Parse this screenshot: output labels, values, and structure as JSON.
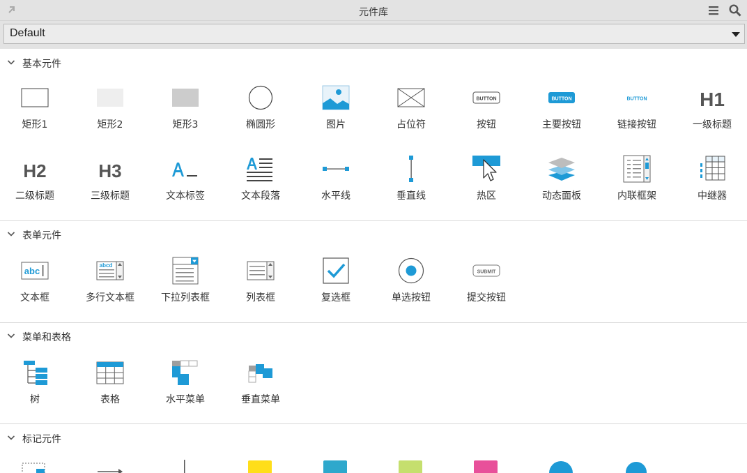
{
  "window": {
    "title": "元件库"
  },
  "library": {
    "selected": "Default"
  },
  "colors": {
    "accent": "#1e9ad6",
    "header_bg": "#e3e3e3"
  },
  "sections": [
    {
      "title": "基本元件",
      "items": [
        {
          "label": "矩形1",
          "icon": "rectangle-outline-icon"
        },
        {
          "label": "矩形2",
          "icon": "rectangle-light-icon"
        },
        {
          "label": "矩形3",
          "icon": "rectangle-gray-icon"
        },
        {
          "label": "椭圆形",
          "icon": "ellipse-icon"
        },
        {
          "label": "图片",
          "icon": "image-icon"
        },
        {
          "label": "占位符",
          "icon": "placeholder-icon"
        },
        {
          "label": "按钮",
          "icon": "button-icon",
          "text": "BUTTON"
        },
        {
          "label": "主要按钮",
          "icon": "primary-button-icon",
          "text": "BUTTON"
        },
        {
          "label": "链接按钮",
          "icon": "link-button-icon",
          "text": "BUTTON"
        },
        {
          "label": "一级标题",
          "icon": "heading1-icon",
          "text": "H1"
        },
        {
          "label": "二级标题",
          "icon": "heading2-icon",
          "text": "H2"
        },
        {
          "label": "三级标题",
          "icon": "heading3-icon",
          "text": "H3"
        },
        {
          "label": "文本标签",
          "icon": "text-label-icon"
        },
        {
          "label": "文本段落",
          "icon": "text-paragraph-icon"
        },
        {
          "label": "水平线",
          "icon": "horizontal-line-icon"
        },
        {
          "label": "垂直线",
          "icon": "vertical-line-icon"
        },
        {
          "label": "热区",
          "icon": "hotspot-icon"
        },
        {
          "label": "动态面板",
          "icon": "dynamic-panel-icon"
        },
        {
          "label": "内联框架",
          "icon": "inline-frame-icon"
        },
        {
          "label": "中继器",
          "icon": "repeater-icon"
        }
      ]
    },
    {
      "title": "表单元件",
      "items": [
        {
          "label": "文本框",
          "icon": "text-field-icon",
          "text": "abc"
        },
        {
          "label": "多行文本框",
          "icon": "text-area-icon",
          "text": "abcd"
        },
        {
          "label": "下拉列表框",
          "icon": "droplist-icon"
        },
        {
          "label": "列表框",
          "icon": "list-box-icon"
        },
        {
          "label": "复选框",
          "icon": "checkbox-icon"
        },
        {
          "label": "单选按钮",
          "icon": "radio-button-icon"
        },
        {
          "label": "提交按钮",
          "icon": "submit-button-icon",
          "text": "SUBMIT"
        }
      ]
    },
    {
      "title": "菜单和表格",
      "items": [
        {
          "label": "树",
          "icon": "tree-icon"
        },
        {
          "label": "表格",
          "icon": "table-icon"
        },
        {
          "label": "水平菜单",
          "icon": "horizontal-menu-icon"
        },
        {
          "label": "垂直菜单",
          "icon": "vertical-menu-icon"
        }
      ]
    },
    {
      "title": "标记元件",
      "items": []
    }
  ]
}
